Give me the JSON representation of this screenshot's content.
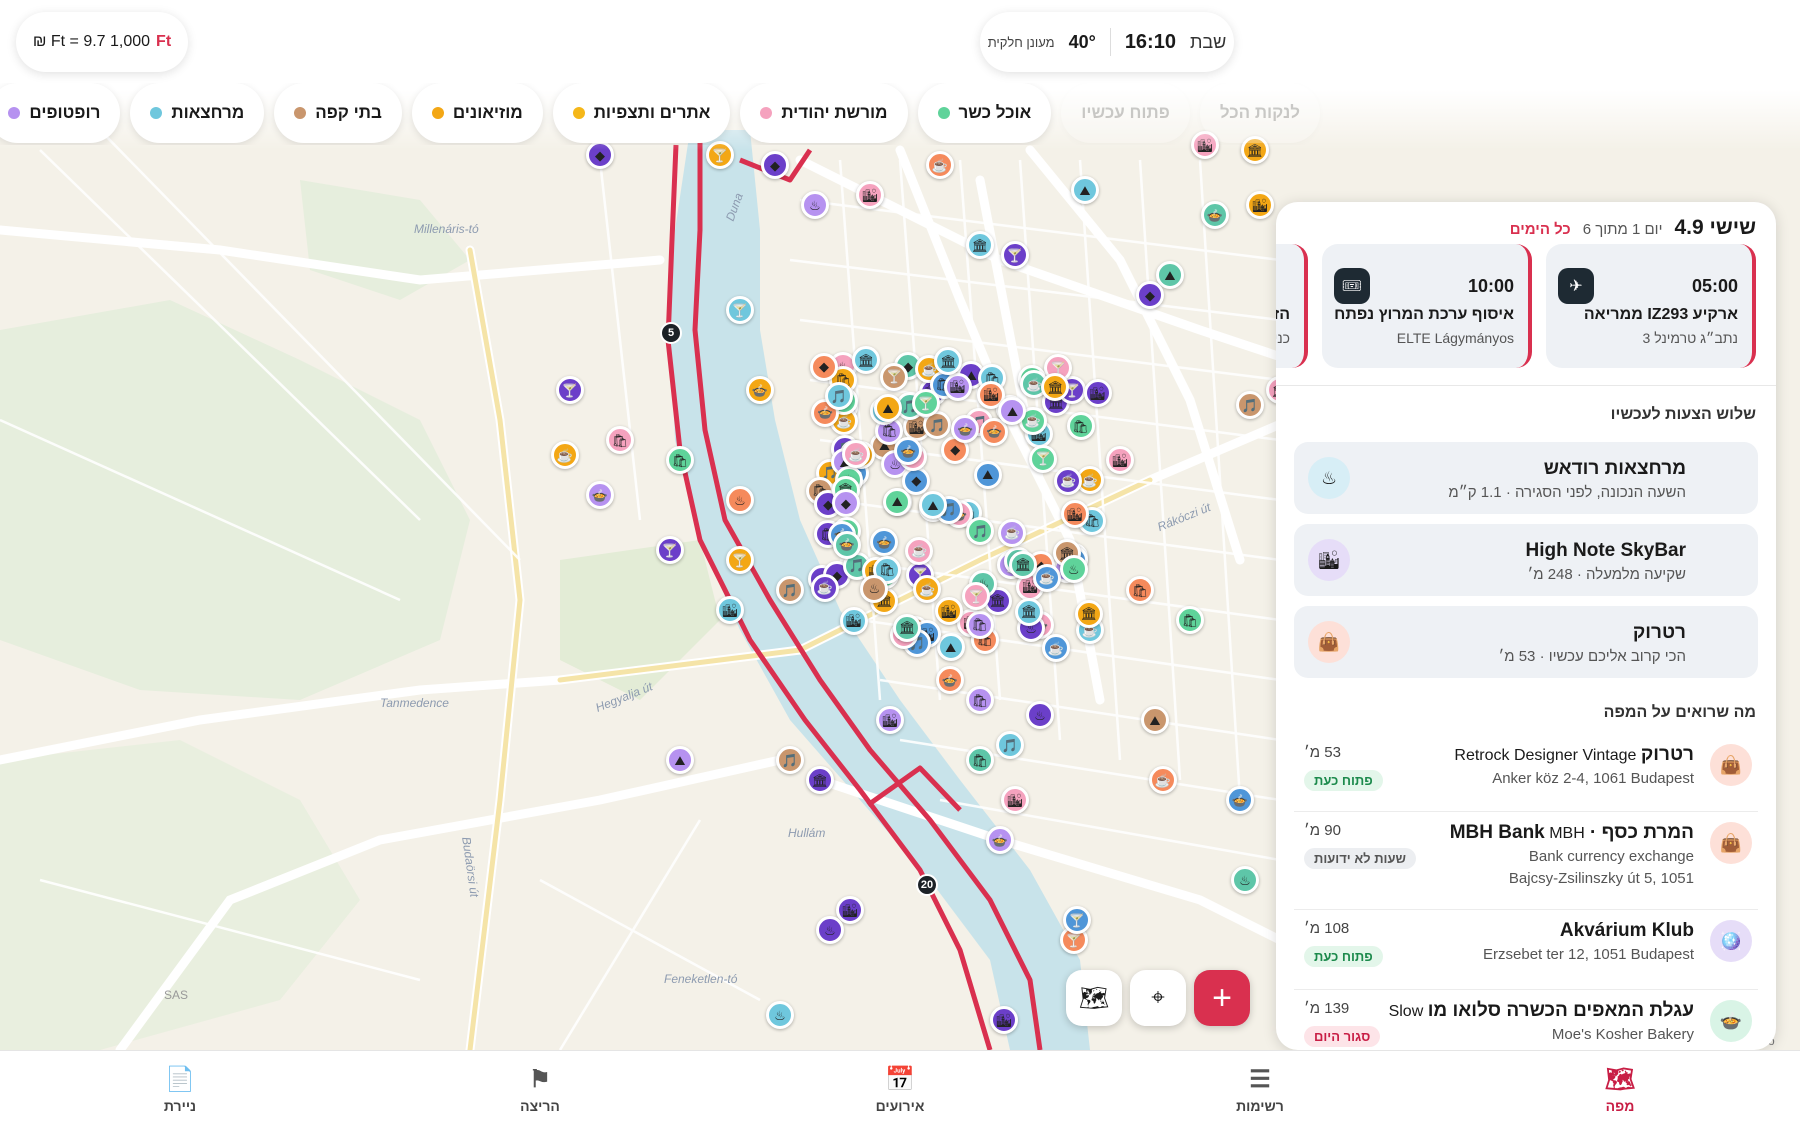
{
  "currency": {
    "rate": "₪ Ft = 9.7 1,000",
    "ft_label": "Ft"
  },
  "weather": {
    "day": "שבת",
    "time": "16:10",
    "temp": "40°",
    "condition": "מעונן חלקית"
  },
  "chips": [
    {
      "label": "לנקות הכל",
      "color": "",
      "faded": true
    },
    {
      "label": "פתוח עכשיו",
      "color": "",
      "faded": true
    },
    {
      "label": "אוכל כשר",
      "color": "#5fd39a",
      "faded": false
    },
    {
      "label": "מורשת יהודית",
      "color": "#f5a2be",
      "faded": false
    },
    {
      "label": "אתרים ותצפיות",
      "color": "#f5b719",
      "faded": false
    },
    {
      "label": "מוזיאונים",
      "color": "#f3a715",
      "faded": false
    },
    {
      "label": "בתי קפה",
      "color": "#c9966d",
      "faded": false
    },
    {
      "label": "מרחצאות",
      "color": "#6fc7dd",
      "faded": false
    },
    {
      "label": "רופטופים",
      "color": "#b692f0",
      "faded": false
    },
    {
      "label": "",
      "color": "#a48af0",
      "faded": false
    }
  ],
  "panel": {
    "day_title": "שישי 4.9",
    "day_of": "יום 1 מתוך 6",
    "all_days": "כל הימים",
    "events": [
      {
        "time": "05:00",
        "icon": "plane-icon",
        "name": "ארקיע IZ293 ממריאה",
        "sub": "נתב״ג טרמינל 3"
      },
      {
        "time": "10:00",
        "icon": "ticket-icon",
        "name": "איסוף ערכת המרוץ נפתח",
        "sub": "ELTE Lágymányos"
      },
      {
        "time": "",
        "icon": "ticket-icon",
        "name": "הז",
        "sub": "כני"
      }
    ],
    "suggestions_title": "שלוש הצעות לעכשיו",
    "suggestions": [
      {
        "title": "מרחצאות רודאש",
        "sub": "השעה הנכונה, לפני הסגירה · 1.1 ק״מ",
        "icon": "bath-icon",
        "bg": "#d7eef6"
      },
      {
        "title": "High Note SkyBar",
        "sub": "שקיעה מלמעלה · 248 מ׳",
        "icon": "skyline-icon",
        "bg": "#e6ddf8"
      },
      {
        "title": "רטרוק",
        "sub": "הכי קרוב אליכם עכשיו · 53 מ׳",
        "icon": "shopping-bag-icon",
        "bg": "#fde0d8"
      }
    ],
    "map_list_title": "מה שרואים על המפה",
    "places": [
      {
        "name": "רטרוק",
        "name2": "Retrock Designer Vintage",
        "line2": "Anker köz 2-4, 1061 Budapest",
        "line3": "",
        "dist": "53 מ׳",
        "badge": "פתוח כעת",
        "badge_type": "open",
        "icon": "shopping-bag-icon",
        "bg": "#fde0d8"
      },
      {
        "name": "המרת כסף · MBH Bank",
        "name2": "MBH",
        "line2": "Bank currency exchange",
        "line3": "Bajcsy-Zsilinszky út 5, 1051",
        "dist": "90 מ׳",
        "badge": "שעות לא ידועות",
        "badge_type": "unknown",
        "icon": "shopping-bag-icon",
        "bg": "#fde0d8"
      },
      {
        "name": "Akvárium Klub",
        "name2": "",
        "line2": "Erzsebet ter 12, 1051 Budapest",
        "line3": "",
        "dist": "108 מ׳",
        "badge": "פתוח כעת",
        "badge_type": "open",
        "icon": "disco-ball-icon",
        "bg": "#e6ddf8"
      },
      {
        "name": "עגלת המאפים הכשרה סלואו מו",
        "name2": "Slow",
        "line2": "Moe's Kosher Bakery",
        "line3": "",
        "dist": "139 מ׳",
        "badge": "סגור היום",
        "badge_type": "closed",
        "icon": "food-icon",
        "bg": "#d9f4e6"
      }
    ]
  },
  "map": {
    "labels": [
      "Millenáris-tó",
      "Tanmedence",
      "Hegyalja út",
      "Budaörsi út",
      "Hullám",
      "Feneketlen-tó",
      "Rákóczi út",
      "Duna",
      "SAS",
      "ro"
    ],
    "route_markers": [
      "5",
      "20"
    ]
  },
  "nav": {
    "tabs": [
      {
        "label": "מפה",
        "icon": "map-icon",
        "active": true
      },
      {
        "label": "רשימות",
        "icon": "list-icon",
        "active": false
      },
      {
        "label": "אירועים",
        "icon": "calendar-icon",
        "active": false
      },
      {
        "label": "הריצה",
        "icon": "flag-icon",
        "active": false
      },
      {
        "label": "ניירת",
        "icon": "document-icon",
        "active": false
      }
    ]
  },
  "colors": {
    "accent": "#d9304f",
    "water": "#c8e3ea",
    "park": "#e2ecd8",
    "route": "#d9304f"
  }
}
